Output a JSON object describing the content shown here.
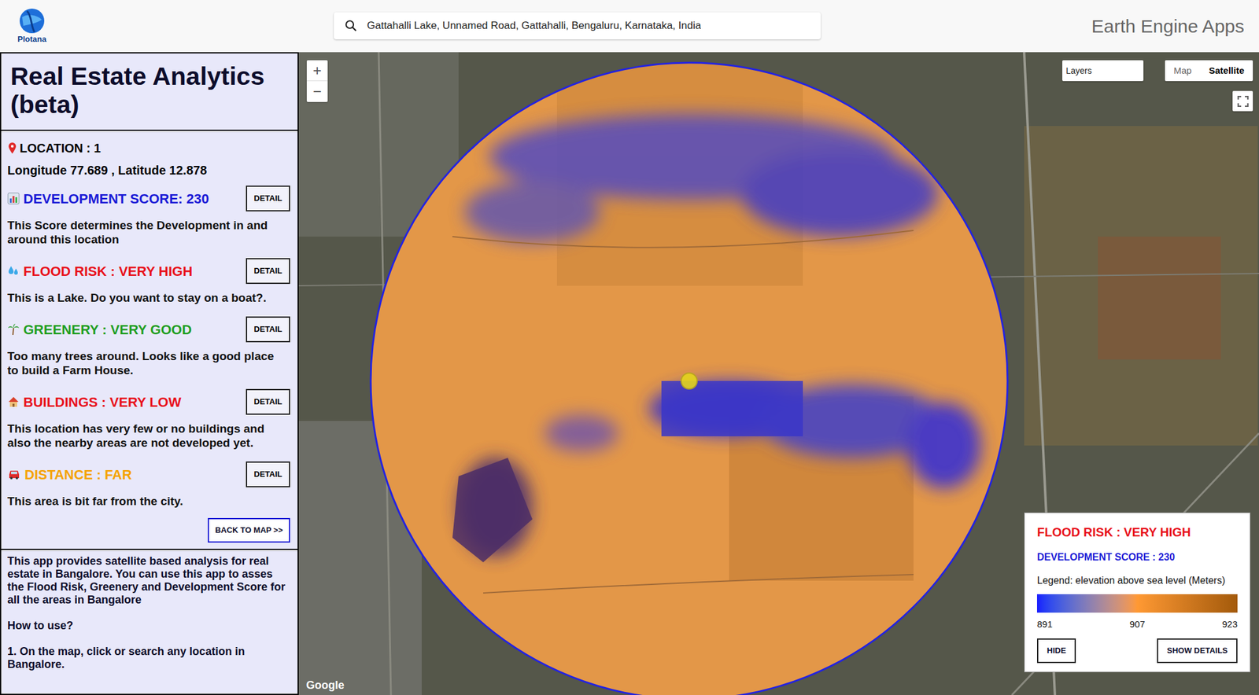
{
  "header": {
    "logo": "Plotana",
    "search": "Gattahalli Lake, Unnamed Road, Gattahalli, Bengaluru, Karnataka, India",
    "brand": "Earth Engine Apps"
  },
  "panel": {
    "title": "Real Estate Analytics (beta)",
    "location": "LOCATION : 1",
    "coordinates": "Longitude 77.689 , Latitude 12.878",
    "metrics": [
      {
        "title": "DEVELOPMENT SCORE: 230",
        "button": "DETAIL",
        "description": "This Score determines the Development in and around this location",
        "color": "#1a1ad6"
      },
      {
        "title": "FLOOD RISK : VERY HIGH",
        "button": "DETAIL",
        "description": "This is a Lake. Do you want to stay on a boat?.",
        "color": "#e8101a"
      },
      {
        "title": "GREENERY : VERY GOOD",
        "button": "DETAIL",
        "description": "Too many trees around. Looks like a good place to build a Farm House.",
        "color": "#1f9e1f"
      },
      {
        "title": "BUILDINGS : VERY LOW",
        "button": "DETAIL",
        "description": "This location has very few or no buildings and also the nearby areas are not developed yet.",
        "color": "#e8101a"
      },
      {
        "title": "DISTANCE : FAR",
        "button": "DETAIL",
        "description": "This area is bit far from the city.",
        "color": "#f5a300"
      }
    ],
    "back_button": "BACK TO MAP >>",
    "about": "This app provides satellite based analysis for real estate in Bangalore. You can use this app to asses the Flood Risk, Greenery and Development Score for all the areas in Bangalore",
    "how_to": "How to use?",
    "steps": [
      "1. On the map, click or search any location in Bangalore."
    ]
  },
  "map": {
    "zoom_in": "+",
    "zoom_out": "−",
    "layers": "Layers",
    "map_types": [
      {
        "label": "Map",
        "selected": false
      },
      {
        "label": "Satellite",
        "selected": true
      }
    ],
    "attribution": "Google"
  },
  "legend": {
    "flood": "FLOOD RISK : VERY HIGH",
    "flood_color": "#e8101a",
    "development": "DEVELOPMENT SCORE : 230",
    "development_color": "#1a1ad6",
    "caption": "Legend: elevation above sea level (Meters)",
    "min": "891",
    "mid": "907",
    "max": "923",
    "buttons": [
      "HIDE",
      "SHOW DETAILS"
    ]
  }
}
